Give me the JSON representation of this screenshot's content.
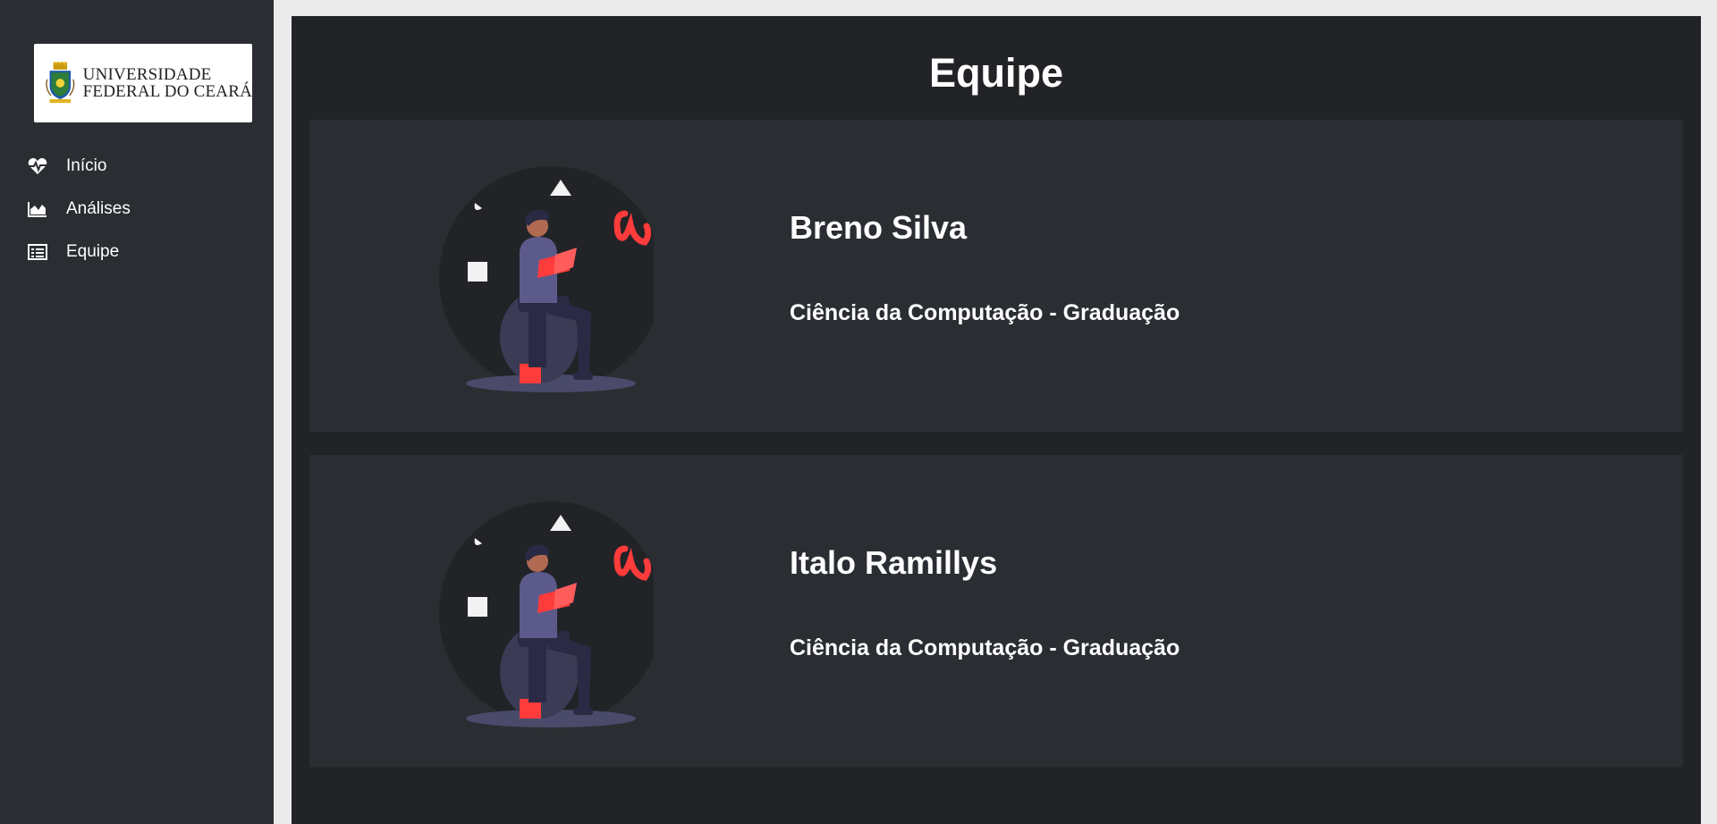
{
  "logo": {
    "line1": "UNIVERSIDADE",
    "line2": "FEDERAL DO CEARÁ"
  },
  "sidebar": {
    "items": [
      {
        "label": "Início",
        "icon": "heartbeat-icon"
      },
      {
        "label": "Análises",
        "icon": "area-chart-icon"
      },
      {
        "label": "Equipe",
        "icon": "list-icon"
      }
    ]
  },
  "page": {
    "title": "Equipe"
  },
  "team": [
    {
      "name": "Breno Silva",
      "course": "Ciência da Computação - Graduação",
      "avatar": "reading-person-illustration"
    },
    {
      "name": "Italo Ramillys",
      "course": "Ciência da Computação - Graduação",
      "avatar": "reading-person-illustration"
    }
  ],
  "colors": {
    "sidebar_bg": "#2a2d32",
    "main_bg": "#212327",
    "card_bg": "#2a2d32",
    "accent_red": "#ff3b3b",
    "figure_purple": "#5c5a8a"
  }
}
